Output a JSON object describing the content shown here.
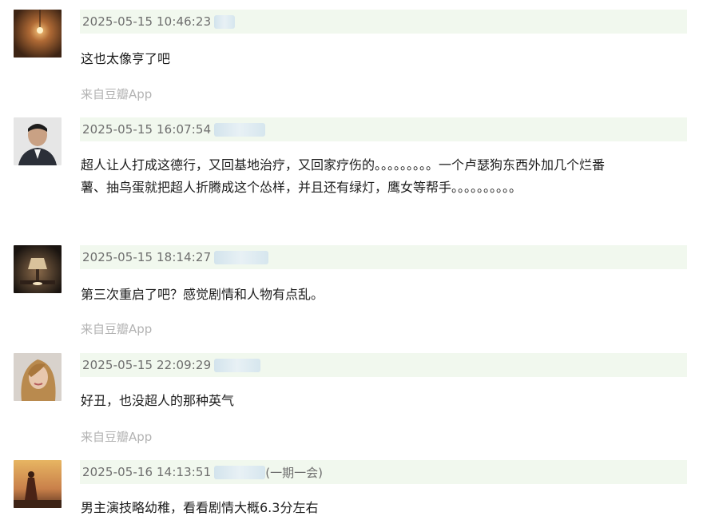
{
  "comments": [
    {
      "timestamp": "2025-05-15 10:46:23",
      "content_lines": [
        "这也太像亨了吧"
      ],
      "source": "来自豆瓣App",
      "avatar_icon": "lamp-avatar-icon"
    },
    {
      "timestamp": "2025-05-15 16:07:54",
      "content_lines": [
        "超人让人打成这德行，又回基地治疗，又回家疗伤的。。。。。。。。。一个卢瑟狗东西外加几个烂番",
        "薯、抽鸟蛋就把超人折腾成这个怂样，并且还有绿灯，鹰女等帮手。。。。。。。。。。"
      ],
      "avatar_icon": "man-portrait-avatar-icon"
    },
    {
      "timestamp": "2025-05-15 18:14:27",
      "content_lines": [
        "第三次重启了吧？感觉剧情和人物有点乱。"
      ],
      "source": "来自豆瓣App",
      "avatar_icon": "table-lamp-avatar-icon"
    },
    {
      "timestamp": "2025-05-15 22:09:29",
      "content_lines": [
        "好丑，也没超人的那种英气"
      ],
      "source": "来自豆瓣App",
      "avatar_icon": "woman-portrait-avatar-icon"
    },
    {
      "timestamp": "2025-05-16 14:13:51",
      "user_suffix": "(一期一会)",
      "content_lines": [
        "男主演技略幼稚，看看剧情大概6.3分左右"
      ],
      "avatar_icon": "sunset-figure-avatar-icon"
    }
  ]
}
